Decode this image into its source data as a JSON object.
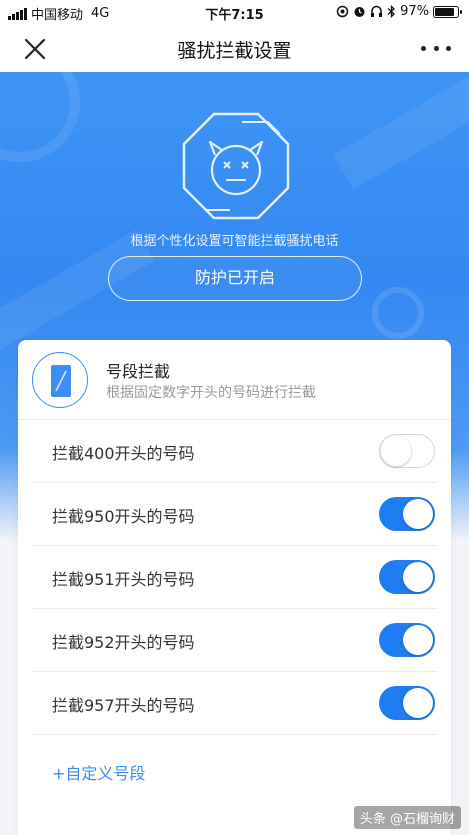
{
  "status_bar": {
    "carrier": "中国移动",
    "network": "4G",
    "time": "下午7:15",
    "battery": "97%",
    "battery_level": 0.97
  },
  "nav": {
    "title": "骚扰拦截设置"
  },
  "hero": {
    "description": "根据个性化设置可智能拦截骚扰电话",
    "protect_button": "防护已开启"
  },
  "segment": {
    "title": "号段拦截",
    "subtitle": "根据固定数字开头的号码进行拦截"
  },
  "rules": [
    {
      "label": "拦截400开头的号码",
      "enabled": false
    },
    {
      "label": "拦截950开头的号码",
      "enabled": true
    },
    {
      "label": "拦截951开头的号码",
      "enabled": true
    },
    {
      "label": "拦截952开头的号码",
      "enabled": true
    },
    {
      "label": "拦截957开头的号码",
      "enabled": true
    }
  ],
  "custom_link": "+自定义号段",
  "watermark": "头条 @石榴询财",
  "colors": {
    "accent": "#1f7df2",
    "hero": "#3488f2"
  }
}
